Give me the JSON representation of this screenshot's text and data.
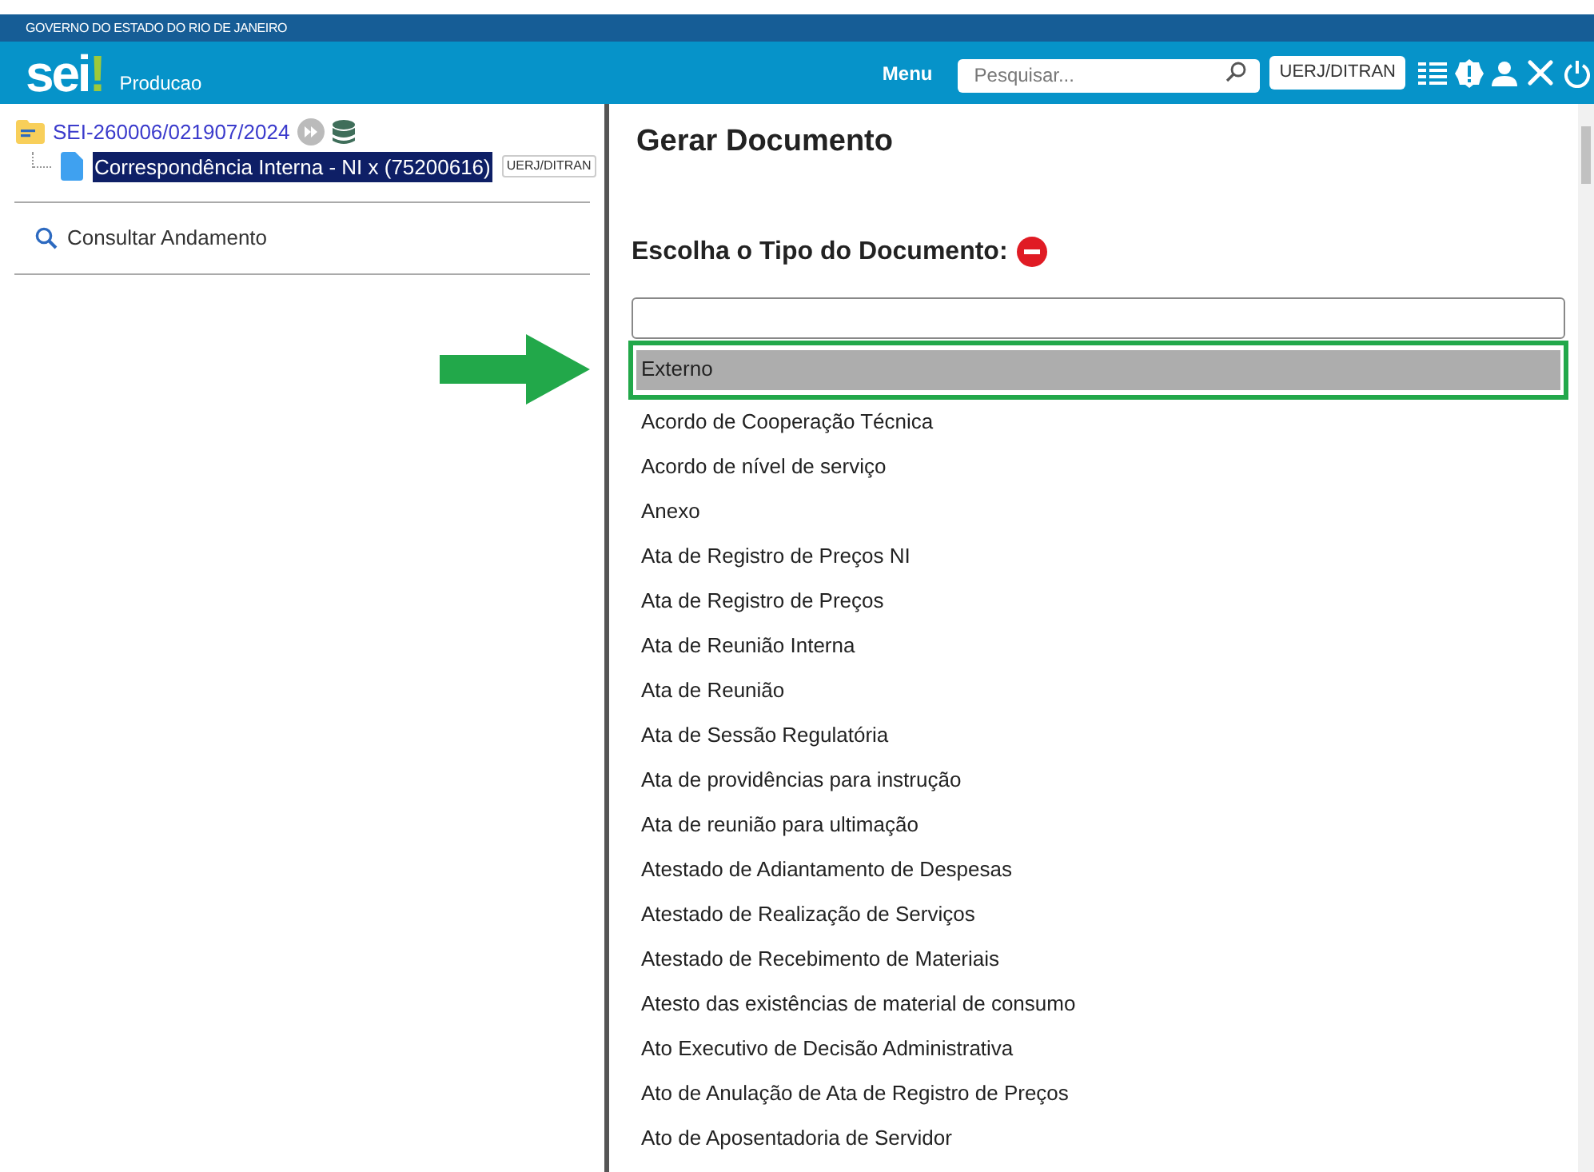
{
  "top_bar": {
    "title": "GOVERNO DO ESTADO DO RIO DE JANEIRO"
  },
  "header": {
    "logo": "sei",
    "logo_mark": "!",
    "environment": "Producao",
    "menu": "Menu",
    "search": {
      "placeholder": "Pesquisar..."
    },
    "unit": "UERJ/DITRAN"
  },
  "tree": {
    "process": "SEI-260006/021907/2024",
    "children": [
      {
        "label": "Correspondência Interna - NI x (75200616)",
        "selected": true,
        "unit": "UERJ/DITRAN"
      }
    ]
  },
  "sidebar": {
    "items": [
      {
        "label": "Consultar Andamento"
      }
    ]
  },
  "main": {
    "title": "Gerar Documento",
    "section": "Escolha o Tipo do Documento:",
    "options": [
      {
        "label": "Externo",
        "selected": true
      },
      {
        "label": "Acordo de Cooperação Técnica",
        "selected": false
      },
      {
        "label": "Acordo de nível de serviço",
        "selected": false
      },
      {
        "label": "Anexo",
        "selected": false
      },
      {
        "label": "Ata de Registro de Preços NI",
        "selected": false
      },
      {
        "label": "Ata de Registro de Preços",
        "selected": false
      },
      {
        "label": "Ata de Reunião Interna",
        "selected": false
      },
      {
        "label": "Ata de Reunião",
        "selected": false
      },
      {
        "label": "Ata de Sessão Regulatória",
        "selected": false
      },
      {
        "label": "Ata de providências para instrução",
        "selected": false
      },
      {
        "label": "Ata de reunião para ultimação",
        "selected": false
      },
      {
        "label": "Atestado de Adiantamento de Despesas",
        "selected": false
      },
      {
        "label": "Atestado de Realização de Serviços",
        "selected": false
      },
      {
        "label": "Atestado de Recebimento de Materiais",
        "selected": false
      },
      {
        "label": "Atesto das existências de material de consumo",
        "selected": false
      },
      {
        "label": "Ato Executivo de Decisão Administrativa",
        "selected": false
      },
      {
        "label": "Ato de Anulação de Ata de Registro de Preços",
        "selected": false
      },
      {
        "label": "Ato de Aposentadoria de Servidor",
        "selected": false
      }
    ]
  }
}
